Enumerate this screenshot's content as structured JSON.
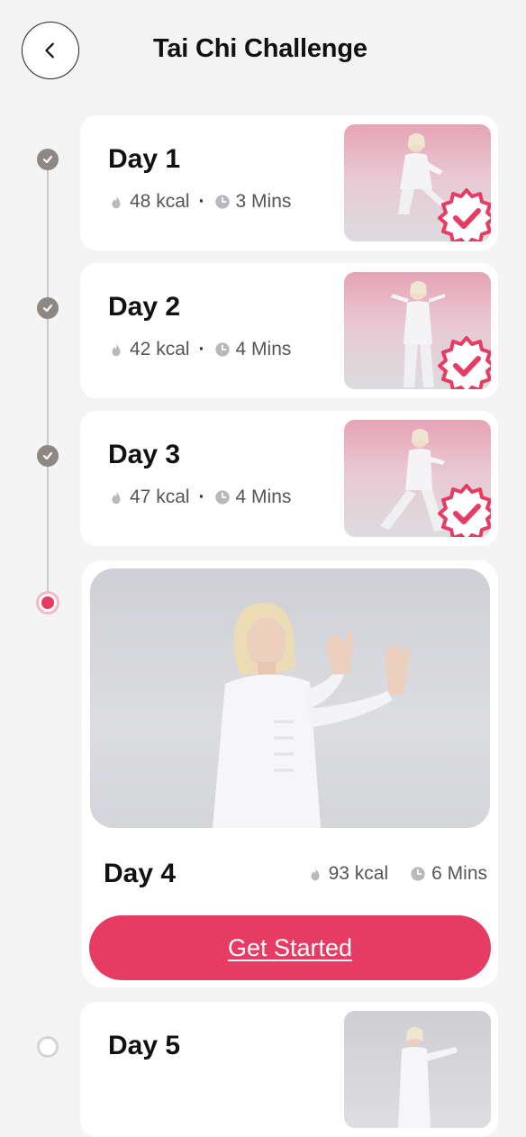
{
  "header": {
    "title": "Tai Chi Challenge",
    "back_icon": "chevron-left-icon"
  },
  "colors": {
    "accent": "#e63c63",
    "done_dot": "#8e8885",
    "background": "#f4f4f5"
  },
  "days": [
    {
      "label": "Day 1",
      "kcal": "48 kcal",
      "duration": "3 Mins",
      "status": "completed"
    },
    {
      "label": "Day 2",
      "kcal": "42 kcal",
      "duration": "4 Mins",
      "status": "completed"
    },
    {
      "label": "Day 3",
      "kcal": "47 kcal",
      "duration": "4 Mins",
      "status": "completed"
    },
    {
      "label": "Day 4",
      "kcal": "93 kcal",
      "duration": "6 Mins",
      "status": "current",
      "cta": "Get Started"
    },
    {
      "label": "Day 5",
      "status": "locked"
    }
  ],
  "meta_separator": "·"
}
